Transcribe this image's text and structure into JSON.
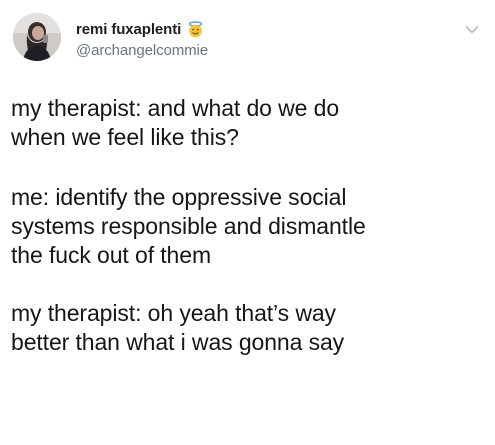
{
  "author": {
    "display_name": "remi fuxaplenti",
    "handle": "@archangelcommie",
    "name_emoji": "smiling-face-with-halo-icon"
  },
  "tweet": {
    "paragraphs": [
      "my therapist: and what do we do\nwhen we feel like this?",
      "me: identify the oppressive social\nsystems responsible and dismantle\nthe fuck out of them",
      "my therapist: oh yeah that’s way\nbetter than what i was gonna say"
    ]
  },
  "colors": {
    "text": "#14171a",
    "handle": "#657786",
    "background": "#ffffff",
    "chevron": "#aab8c2"
  },
  "icons": {
    "menu": "chevron-down-icon"
  }
}
